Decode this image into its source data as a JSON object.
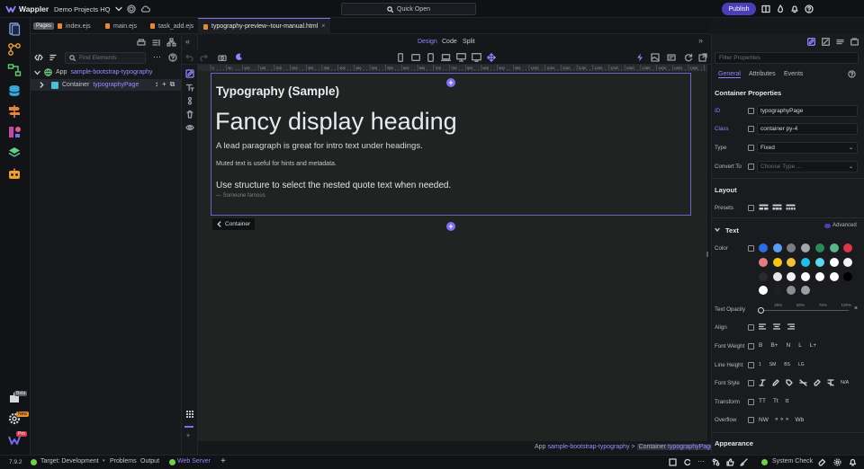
{
  "app": {
    "name": "Wappler",
    "project": "Demo Projects HQ",
    "quick_open": "Quick Open",
    "publish": "Publish"
  },
  "tabs": [
    {
      "label": "Pages",
      "kind": "badge"
    },
    {
      "label": "index.ejs"
    },
    {
      "label": "main.ejs"
    },
    {
      "label": "task_add.ejs"
    },
    {
      "label": "typography-preview--tour-manual.html",
      "active": true,
      "close": "×"
    }
  ],
  "element_panel": {
    "find_placeholder": "Find Elements",
    "tree": {
      "app_label": "App",
      "app_name": "sample-bootstrap-typography",
      "container_label": "Container",
      "container_name": "typographyPage"
    }
  },
  "view_modes": {
    "design": "Design",
    "code": "Code",
    "split": "Split"
  },
  "ruler_ticks": [
    "0",
    "50",
    "100",
    "150",
    "200",
    "250",
    "300",
    "350",
    "400",
    "450",
    "500",
    "550",
    "600",
    "650",
    "700",
    "750",
    "800",
    "850",
    "900",
    "950",
    "1000",
    "1050",
    "1100",
    "1150",
    "1200",
    "1250",
    "1300",
    "1350",
    "1400",
    "1450",
    "1500",
    "1550"
  ],
  "page": {
    "heading": "Typography (Sample)",
    "display": "Fancy display heading",
    "lead": "A lead paragraph is great for intro text under headings.",
    "muted": "Muted text is useful for hints and metadata.",
    "quote": "Use structure to select the nested quote text when needed.",
    "quote_footer": "— Someone famous"
  },
  "selection_badge": "Container",
  "breadcrumb": {
    "app": "App",
    "app_name": "sample-bootstrap-typography",
    "sep": ">",
    "container": "Container",
    "container_name": "typographyPage"
  },
  "bottom_bar": {
    "version": "7.9.2",
    "target": "Target: Development",
    "problems": "Problems",
    "output": "Output",
    "web_server": "Web Server",
    "system_check": "System Check"
  },
  "rail_badges": {
    "beta": "Beta",
    "new": "New",
    "pro": "Pro"
  },
  "properties": {
    "filter_placeholder": "Filter Properties",
    "tabs": [
      "General",
      "Attributes",
      "Events"
    ],
    "section": "Container Properties",
    "id_label": "ID",
    "id_value": "typographyPage",
    "class_label": "Class",
    "class_value": "container py-4",
    "type_label": "Type",
    "type_value": "Fixed",
    "convert_label": "Convert To",
    "convert_placeholder": "Choose Type ...",
    "layout_head": "Layout",
    "presets_label": "Presets",
    "text_head": "Text",
    "advanced": "Advanced",
    "color_label": "Color",
    "colors": [
      "#2b6fe8",
      "#5c9cf5",
      "#7b7d86",
      "#a5a7ae",
      "#2a8a55",
      "#59b58a",
      "#d93848",
      "#e77b86",
      "#f5c518",
      "#f0c23a",
      "#1fbfe6",
      "#5fd6ef",
      "#ffffff",
      "#f2f2f2",
      "#2a2b30",
      "#e6e6e6",
      "#f2f2f2",
      "#ffffff",
      "#ffffff",
      "#ffffff",
      "#000000",
      "#ffffff",
      "#1e1f23",
      "#8a8c93",
      "#9c9ea5"
    ],
    "opacity_label": "Text Opacity",
    "opacity_ticks": [
      "0",
      "25%",
      "50%",
      "75%",
      "100%"
    ],
    "align_label": "Align",
    "weight_label": "Font Weight",
    "weights": [
      "B",
      "B+",
      "N",
      "L",
      "L+"
    ],
    "lineheight_label": "Line Height",
    "lineheights": [
      "1",
      "SM",
      "BS",
      "LG"
    ],
    "fontstyle_label": "Font Style",
    "fontstyle_na": "N/A",
    "transform_label": "Transform",
    "transforms": [
      "TT",
      "Tt",
      "tt"
    ],
    "overflow_label": "Overflow",
    "overflows": [
      "NW",
      "Wb"
    ],
    "appearance_head": "Appearance"
  }
}
